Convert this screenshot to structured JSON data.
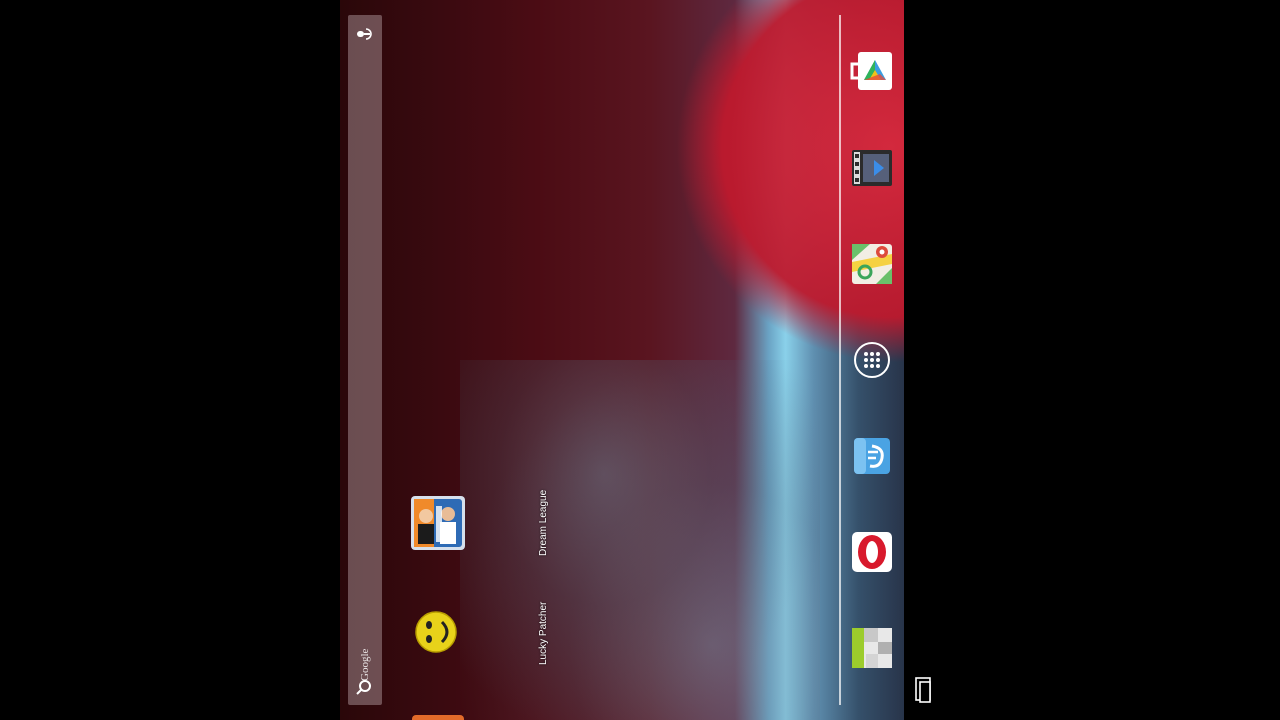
{
  "search": {
    "hint": "Google"
  },
  "desktop": {
    "shortcuts": [
      {
        "label": "Dream League",
        "icon": "dream-league-icon"
      },
      {
        "label": "Lucky Patcher",
        "icon": "lucky-patcher-icon"
      }
    ]
  },
  "dock": {
    "icons": [
      "play-store-icon",
      "video-editor-icon",
      "maps-icon",
      "apps-drawer-icon",
      "es-file-explorer-icon",
      "opera-icon",
      "square-app-icon"
    ]
  },
  "colors": {
    "moon": "#d8243a",
    "sky_highlight": "#8ad1ea",
    "opera_red": "#d8192c"
  }
}
